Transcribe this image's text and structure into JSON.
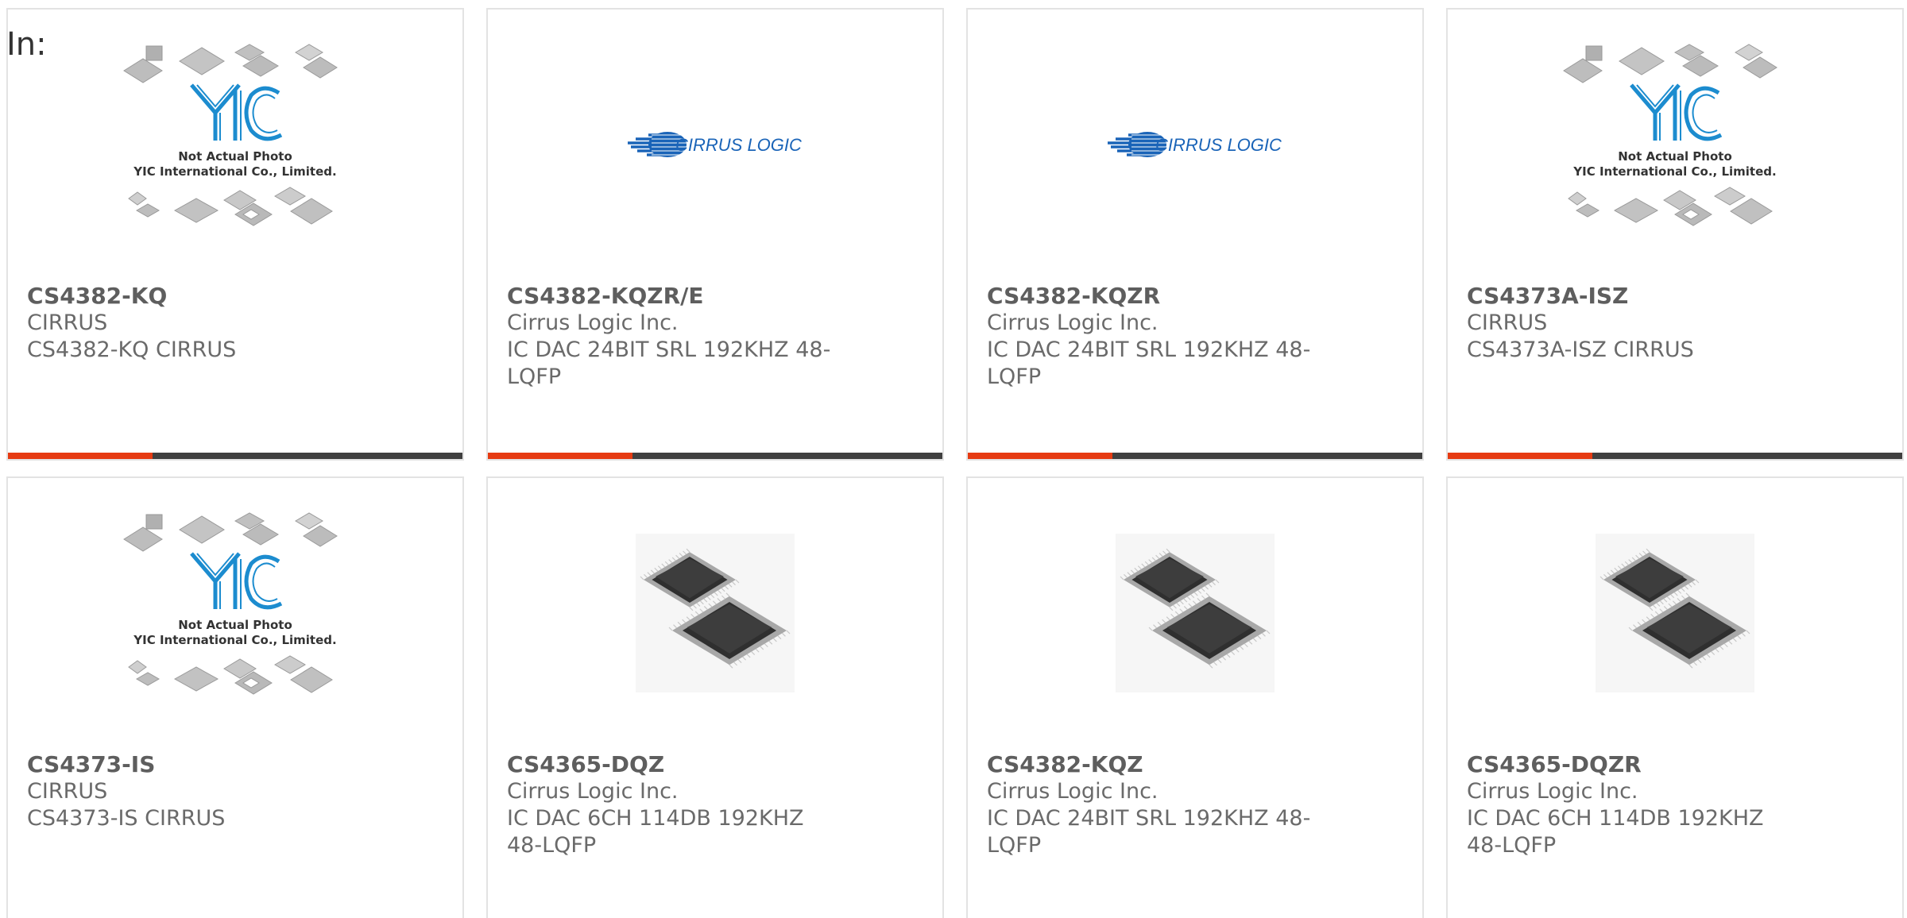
{
  "page": {
    "filter_label": "In:"
  },
  "colors": {
    "accent": "#e63b12",
    "bar_dark": "#404040",
    "yic_blue": "#1c8ccf",
    "cirrus_blue": "#1a64b8"
  },
  "placeholder_image": {
    "line1": "Not Actual Photo",
    "line2": "YIC International Co., Limited."
  },
  "cirrus_logo_text": "CIRRUS LOGIC",
  "products": [
    {
      "part": "CS4382-KQ",
      "maker": "CIRRUS",
      "desc": "CS4382-KQ CIRRUS",
      "image": "yic-placeholder"
    },
    {
      "part": "CS4382-KQZR/E",
      "maker": "Cirrus Logic Inc.",
      "desc": "IC DAC 24BIT SRL 192KHZ 48-LQFP",
      "image": "cirrus-logo"
    },
    {
      "part": "CS4382-KQZR",
      "maker": "Cirrus Logic Inc.",
      "desc": "IC DAC 24BIT SRL 192KHZ 48-LQFP",
      "image": "cirrus-logo"
    },
    {
      "part": "CS4373A-ISZ",
      "maker": "CIRRUS",
      "desc": "CS4373A-ISZ CIRRUS",
      "image": "yic-placeholder"
    },
    {
      "part": "CS4373-IS",
      "maker": "CIRRUS",
      "desc": "CS4373-IS CIRRUS",
      "image": "yic-placeholder"
    },
    {
      "part": "CS4365-DQZ",
      "maker": "Cirrus Logic Inc.",
      "desc": "IC DAC 6CH 114DB 192KHZ 48-LQFP",
      "image": "lqfp-chip"
    },
    {
      "part": "CS4382-KQZ",
      "maker": "Cirrus Logic Inc.",
      "desc": "IC DAC 24BIT SRL 192KHZ 48-LQFP",
      "image": "lqfp-chip"
    },
    {
      "part": "CS4365-DQZR",
      "maker": "Cirrus Logic Inc.",
      "desc": "IC DAC 6CH 114DB 192KHZ 48-LQFP",
      "image": "lqfp-chip"
    }
  ]
}
